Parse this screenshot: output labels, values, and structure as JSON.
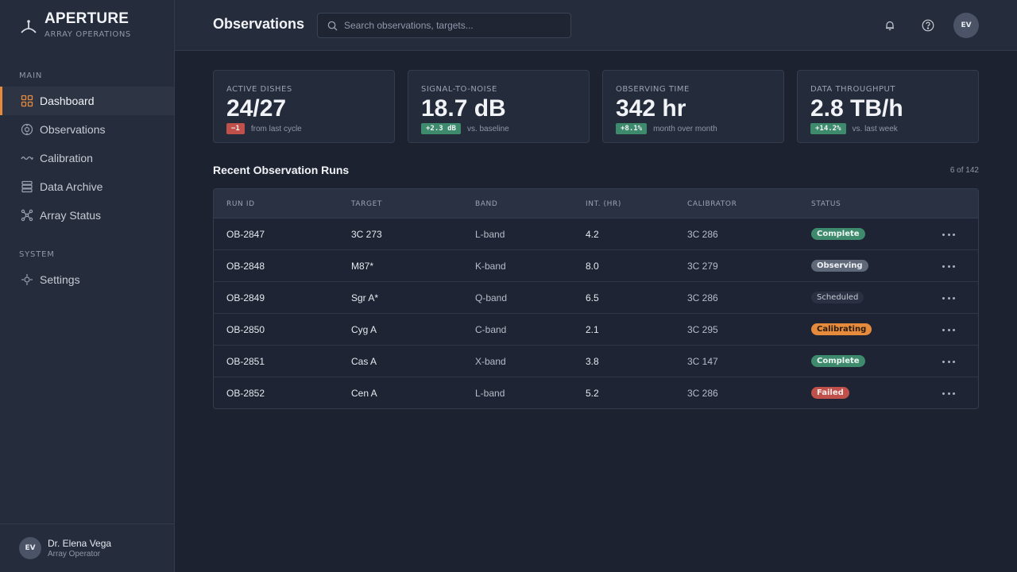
{
  "brand": {
    "name": "APERTURE",
    "subtitle": "ARRAY OPERATIONS"
  },
  "sidebar": {
    "sections": [
      {
        "label": "MAIN"
      },
      {
        "label": "SYSTEM"
      }
    ],
    "items": [
      {
        "label": "Dashboard",
        "icon": "grid-icon",
        "active": true
      },
      {
        "label": "Observations",
        "icon": "target-icon"
      },
      {
        "label": "Calibration",
        "icon": "wave-icon"
      },
      {
        "label": "Data Archive",
        "icon": "database-icon"
      },
      {
        "label": "Array Status",
        "icon": "network-icon"
      },
      {
        "label": "Settings",
        "icon": "gear-icon"
      }
    ],
    "user": {
      "initials": "EV",
      "name": "Dr. Elena Vega",
      "role": "Array Operator"
    }
  },
  "header": {
    "title": "Observations",
    "search_placeholder": "Search observations, targets...",
    "avatar_initials": "EV"
  },
  "stats": [
    {
      "label": "ACTIVE DISHES",
      "value": "24/27",
      "delta": "−1",
      "delta_type": "neg",
      "note": "from last cycle"
    },
    {
      "label": "SIGNAL-TO-NOISE",
      "value": "18.7 dB",
      "delta": "+2.3 dB",
      "delta_type": "pos",
      "note": "vs. baseline"
    },
    {
      "label": "OBSERVING TIME",
      "value": "342 hr",
      "delta": "+8.1%",
      "delta_type": "pos",
      "note": "month over month"
    },
    {
      "label": "DATA THROUGHPUT",
      "value": "2.8 TB/h",
      "delta": "+14.2%",
      "delta_type": "pos",
      "note": "vs. last week"
    }
  ],
  "runs": {
    "title": "Recent Observation Runs",
    "count": "6 of 142",
    "columns": [
      "RUN ID",
      "TARGET",
      "BAND",
      "INT. (HR)",
      "CALIBRATOR",
      "STATUS"
    ],
    "rows": [
      {
        "id": "OB-2847",
        "target": "3C 273",
        "band": "L-band",
        "int": "4.2",
        "calibrator": "3C 286",
        "status": "Complete",
        "status_type": "complete"
      },
      {
        "id": "OB-2848",
        "target": "M87*",
        "band": "K-band",
        "int": "8.0",
        "calibrator": "3C 279",
        "status": "Observing",
        "status_type": "observing"
      },
      {
        "id": "OB-2849",
        "target": "Sgr A*",
        "band": "Q-band",
        "int": "6.5",
        "calibrator": "3C 286",
        "status": "Scheduled",
        "status_type": "scheduled"
      },
      {
        "id": "OB-2850",
        "target": "Cyg A",
        "band": "C-band",
        "int": "2.1",
        "calibrator": "3C 295",
        "status": "Calibrating",
        "status_type": "calibrating"
      },
      {
        "id": "OB-2851",
        "target": "Cas A",
        "band": "X-band",
        "int": "3.8",
        "calibrator": "3C 147",
        "status": "Complete",
        "status_type": "complete"
      },
      {
        "id": "OB-2852",
        "target": "Cen A",
        "band": "L-band",
        "int": "5.2",
        "calibrator": "3C 286",
        "status": "Failed",
        "status_type": "failed"
      }
    ]
  },
  "colors": {
    "accent": "#e68a3c",
    "success": "#3d8a6d",
    "danger": "#c0504a",
    "neutral": "#5f6878"
  }
}
